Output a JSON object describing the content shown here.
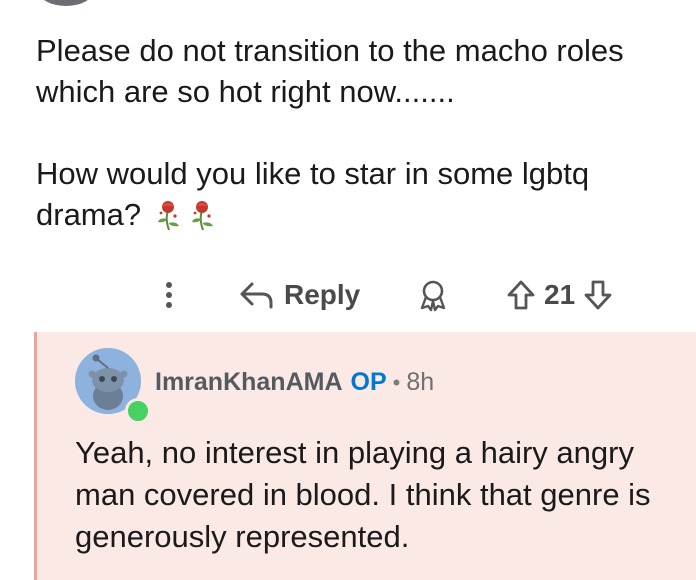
{
  "comment": {
    "paragraphs": [
      "Please do not transition to the macho roles which are so hot right now.......",
      "How would you like to star in some lgbtq drama?"
    ],
    "emoji": [
      "wilted-rose-emoji",
      "wilted-rose-emoji"
    ]
  },
  "actions": {
    "more_icon": "more-vertical-icon",
    "reply_label": "Reply",
    "award_icon": "award-icon",
    "vote_count": "21"
  },
  "reply": {
    "username": "ImranKhanAMA",
    "op_badge": "OP",
    "separator": "•",
    "time": "8h",
    "text": "Yeah, no interest in playing a hairy angry man covered in blood. I think that genre is generously represented."
  },
  "colors": {
    "op": "#0079d3",
    "reply_background": "#fbe9e5",
    "thread_line": "#f0a592",
    "online": "#46d160"
  }
}
